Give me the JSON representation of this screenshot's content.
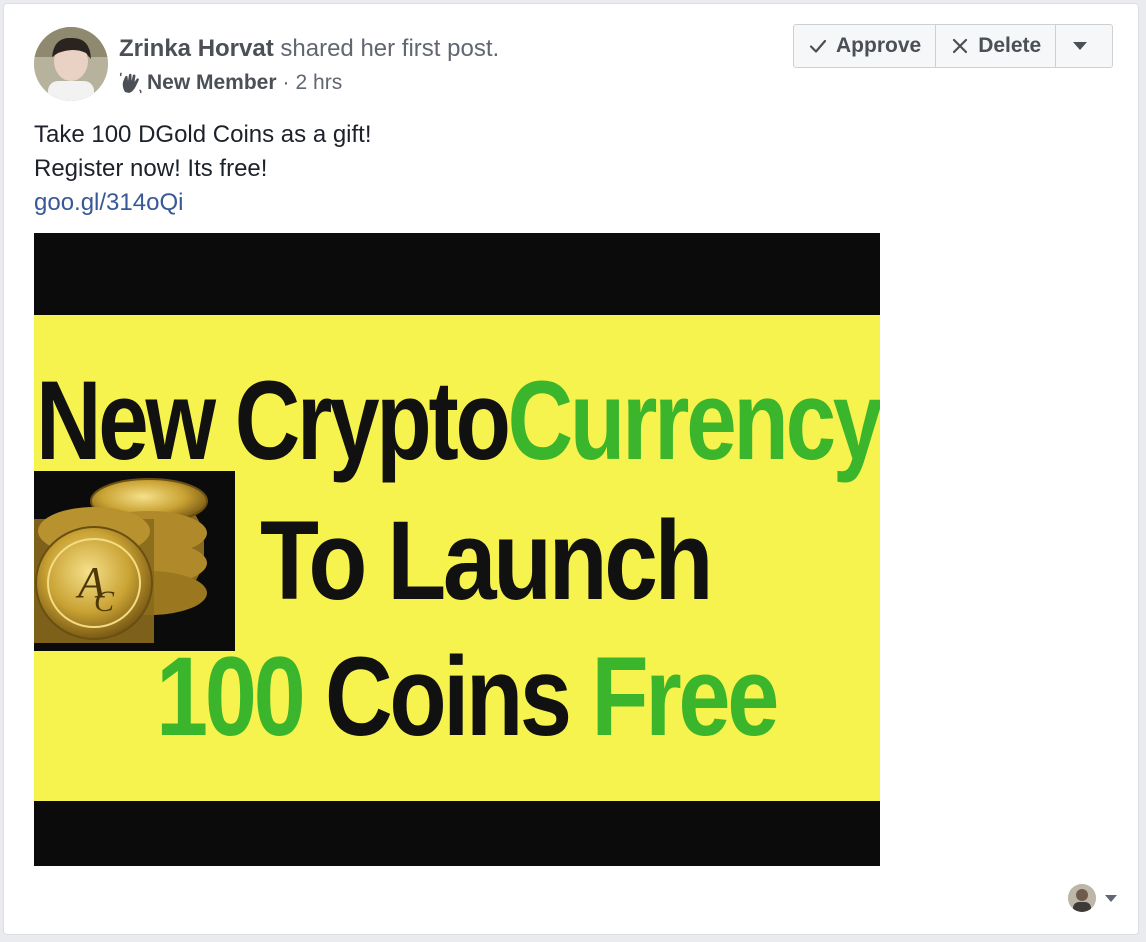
{
  "post": {
    "author": "Zrinka Horvat",
    "action_text": " shared her first post.",
    "badge": "New Member",
    "separator": "·",
    "time": "2 hrs",
    "body_line1": "Take 100 DGold Coins as a gift!",
    "body_line2": "Register now! Its free!",
    "link": "goo.gl/314oQi"
  },
  "actions": {
    "approve": "Approve",
    "delete": "Delete"
  },
  "image": {
    "line1_dark": "New Crypto",
    "line1_green": "Currency",
    "line2": "To Launch",
    "line3_green_a": "100",
    "line3_dark": " Coins ",
    "line3_green_b": "Free"
  },
  "colors": {
    "banner": "#f6f34f",
    "green": "#3bb52c",
    "link": "#385898"
  },
  "icons": {
    "approve": "check-icon",
    "delete": "close-icon",
    "more": "chevron-down-icon",
    "badge": "waving-hand-icon"
  }
}
